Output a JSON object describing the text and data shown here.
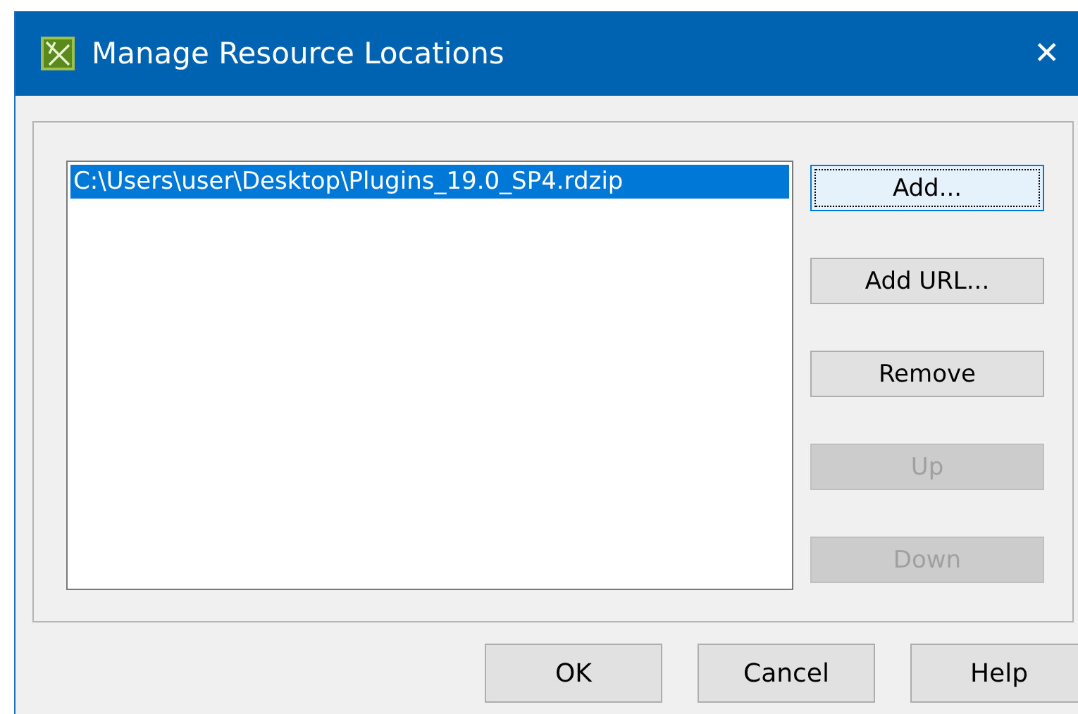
{
  "window": {
    "title": "Manage Resource Locations",
    "close": "✕"
  },
  "locations": [
    {
      "path": "C:\\Users\\user\\Desktop\\Plugins_19.0_SP4.rdzip",
      "selected": true
    }
  ],
  "side_buttons": [
    {
      "label": "Add...",
      "disabled": false,
      "focused": true
    },
    {
      "label": "Add URL...",
      "disabled": false,
      "focused": false
    },
    {
      "label": "Remove",
      "disabled": false,
      "focused": false
    },
    {
      "label": "Up",
      "disabled": true,
      "focused": false
    },
    {
      "label": "Down",
      "disabled": true,
      "focused": false
    }
  ],
  "footer_buttons": [
    "OK",
    "Cancel",
    "Help"
  ]
}
